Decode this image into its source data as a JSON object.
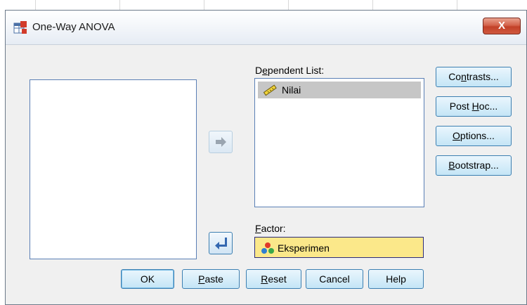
{
  "window": {
    "title": "One-Way ANOVA",
    "close_label": "X"
  },
  "dependent": {
    "label_pre": "D",
    "label_under": "e",
    "label_post": "pendent List:",
    "items": [
      "Nilai"
    ]
  },
  "factor": {
    "label_pre": "",
    "label_under": "F",
    "label_post": "actor:",
    "value": "Eksperimen"
  },
  "side_buttons": {
    "contrasts": {
      "pre": "Co",
      "u": "n",
      "post": "trasts..."
    },
    "posthoc": {
      "pre": "Post ",
      "u": "H",
      "post": "oc..."
    },
    "options": {
      "pre": "",
      "u": "O",
      "post": "ptions..."
    },
    "bootstrap": {
      "pre": "",
      "u": "B",
      "post": "ootstrap..."
    }
  },
  "bottom_buttons": {
    "ok": "OK",
    "paste": {
      "pre": "",
      "u": "P",
      "post": "aste"
    },
    "reset": {
      "pre": "",
      "u": "R",
      "post": "eset"
    },
    "cancel": "Cancel",
    "help": "Help"
  },
  "colors": {
    "factor_bg": "#fbe88a",
    "close_red": "#c24128",
    "list_border": "#5a7fb5"
  },
  "icons": {
    "app": "anova-app-icon",
    "scale": "ruler-scale-icon",
    "nominal": "nominal-balls-icon",
    "move_right": "arrow-right-icon",
    "move_left": "arrow-return-left-icon"
  }
}
